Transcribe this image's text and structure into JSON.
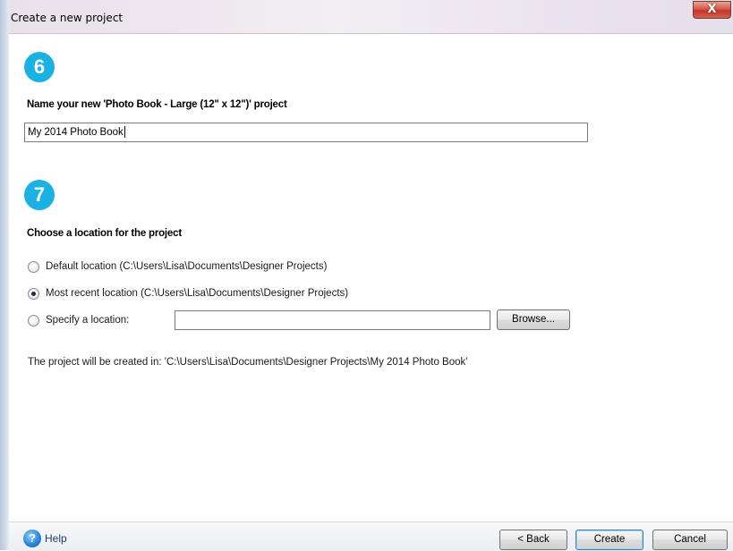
{
  "window": {
    "title": "Create a new project",
    "close_glyph": "X"
  },
  "step6": {
    "number": "6",
    "heading": "Name your new 'Photo Book - Large (12\" x 12\")' project",
    "project_name_value": "My 2014 Photo Book"
  },
  "step7": {
    "number": "7",
    "heading": "Choose a location for the project",
    "options": [
      {
        "label": "Default location (C:\\Users\\Lisa\\Documents\\Designer Projects)",
        "selected": false
      },
      {
        "label": "Most recent location (C:\\Users\\Lisa\\Documents\\Designer Projects)",
        "selected": true
      },
      {
        "label": "Specify a location:",
        "selected": false
      }
    ],
    "specify_location_value": "",
    "browse_label": "Browse...",
    "result_text": "The project will be created in: 'C:\\Users\\Lisa\\Documents\\Designer Projects\\My 2014 Photo Book'"
  },
  "footer": {
    "help_icon_glyph": "?",
    "help_label": "Help",
    "back_label": "< Back",
    "create_label": "Create",
    "cancel_label": "Cancel"
  },
  "colors": {
    "step_badge": "#1ab2e3",
    "close_button": "#c2352a",
    "primary_button_border": "#3c7fb1"
  }
}
